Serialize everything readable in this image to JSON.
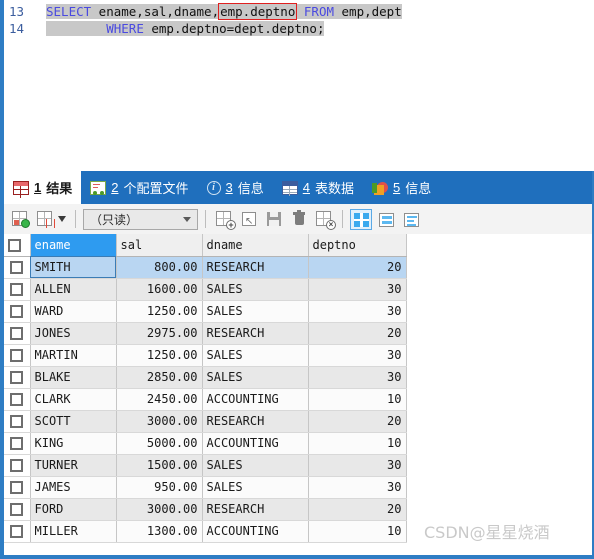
{
  "editor": {
    "line_numbers": [
      "13",
      "14"
    ],
    "line13": {
      "kw_select": "SELECT",
      "cols": " ename,sal,dname,",
      "highlighted_col": "emp.deptno",
      "kw_from": "FROM",
      "tables": " emp,dept"
    },
    "line14": {
      "indent": "        ",
      "kw_where": "WHERE",
      "condition": " emp.deptno=dept.deptno;"
    }
  },
  "tabs": [
    {
      "num": "1",
      "label": "结果",
      "icon": "result-grid-icon",
      "active": true
    },
    {
      "num": "2",
      "label": "个配置文件",
      "icon": "profile-icon",
      "active": false
    },
    {
      "num": "3",
      "label": "信息",
      "icon": "info-icon",
      "active": false
    },
    {
      "num": "4",
      "label": "表数据",
      "icon": "table-data-icon",
      "active": false
    },
    {
      "num": "5",
      "label": "信息",
      "icon": "chart-pie-icon",
      "active": false
    }
  ],
  "toolbar": {
    "new_record_label": "新建记录",
    "delete_record_label": "删除记录",
    "mode_select_value": "（只读）",
    "apply_label": "应用更改",
    "revert_label": "撤销更改",
    "save_label": "保存",
    "trash_label": "删除",
    "cancel_label": "取消",
    "view_grid_label": "网格视图",
    "view_form_label": "表单视图",
    "view_text_label": "文本视图"
  },
  "grid": {
    "columns": [
      "ename",
      "sal",
      "dname",
      "deptno"
    ],
    "active_column": "ename",
    "selected_row_index": 0,
    "rows": [
      {
        "ename": "SMITH",
        "sal": "800.00",
        "dname": "RESEARCH",
        "deptno": "20"
      },
      {
        "ename": "ALLEN",
        "sal": "1600.00",
        "dname": "SALES",
        "deptno": "30"
      },
      {
        "ename": "WARD",
        "sal": "1250.00",
        "dname": "SALES",
        "deptno": "30"
      },
      {
        "ename": "JONES",
        "sal": "2975.00",
        "dname": "RESEARCH",
        "deptno": "20"
      },
      {
        "ename": "MARTIN",
        "sal": "1250.00",
        "dname": "SALES",
        "deptno": "30"
      },
      {
        "ename": "BLAKE",
        "sal": "2850.00",
        "dname": "SALES",
        "deptno": "30"
      },
      {
        "ename": "CLARK",
        "sal": "2450.00",
        "dname": "ACCOUNTING",
        "deptno": "10"
      },
      {
        "ename": "SCOTT",
        "sal": "3000.00",
        "dname": "RESEARCH",
        "deptno": "20"
      },
      {
        "ename": "KING",
        "sal": "5000.00",
        "dname": "ACCOUNTING",
        "deptno": "10"
      },
      {
        "ename": "TURNER",
        "sal": "1500.00",
        "dname": "SALES",
        "deptno": "30"
      },
      {
        "ename": "JAMES",
        "sal": "950.00",
        "dname": "SALES",
        "deptno": "30"
      },
      {
        "ename": "FORD",
        "sal": "3000.00",
        "dname": "RESEARCH",
        "deptno": "20"
      },
      {
        "ename": "MILLER",
        "sal": "1300.00",
        "dname": "ACCOUNTING",
        "deptno": "10"
      }
    ]
  },
  "watermark": {
    "text": "CSDN@星星烧酒"
  },
  "colors": {
    "accent_blue": "#1f6fbd",
    "frame_blue": "#2e7dc4",
    "keyword": "#4a4ae0",
    "highlight_box": "#e02020",
    "selection_gray": "#c8c8c8",
    "row_selected": "#b9d6f2",
    "header_active": "#2e9bf0"
  }
}
